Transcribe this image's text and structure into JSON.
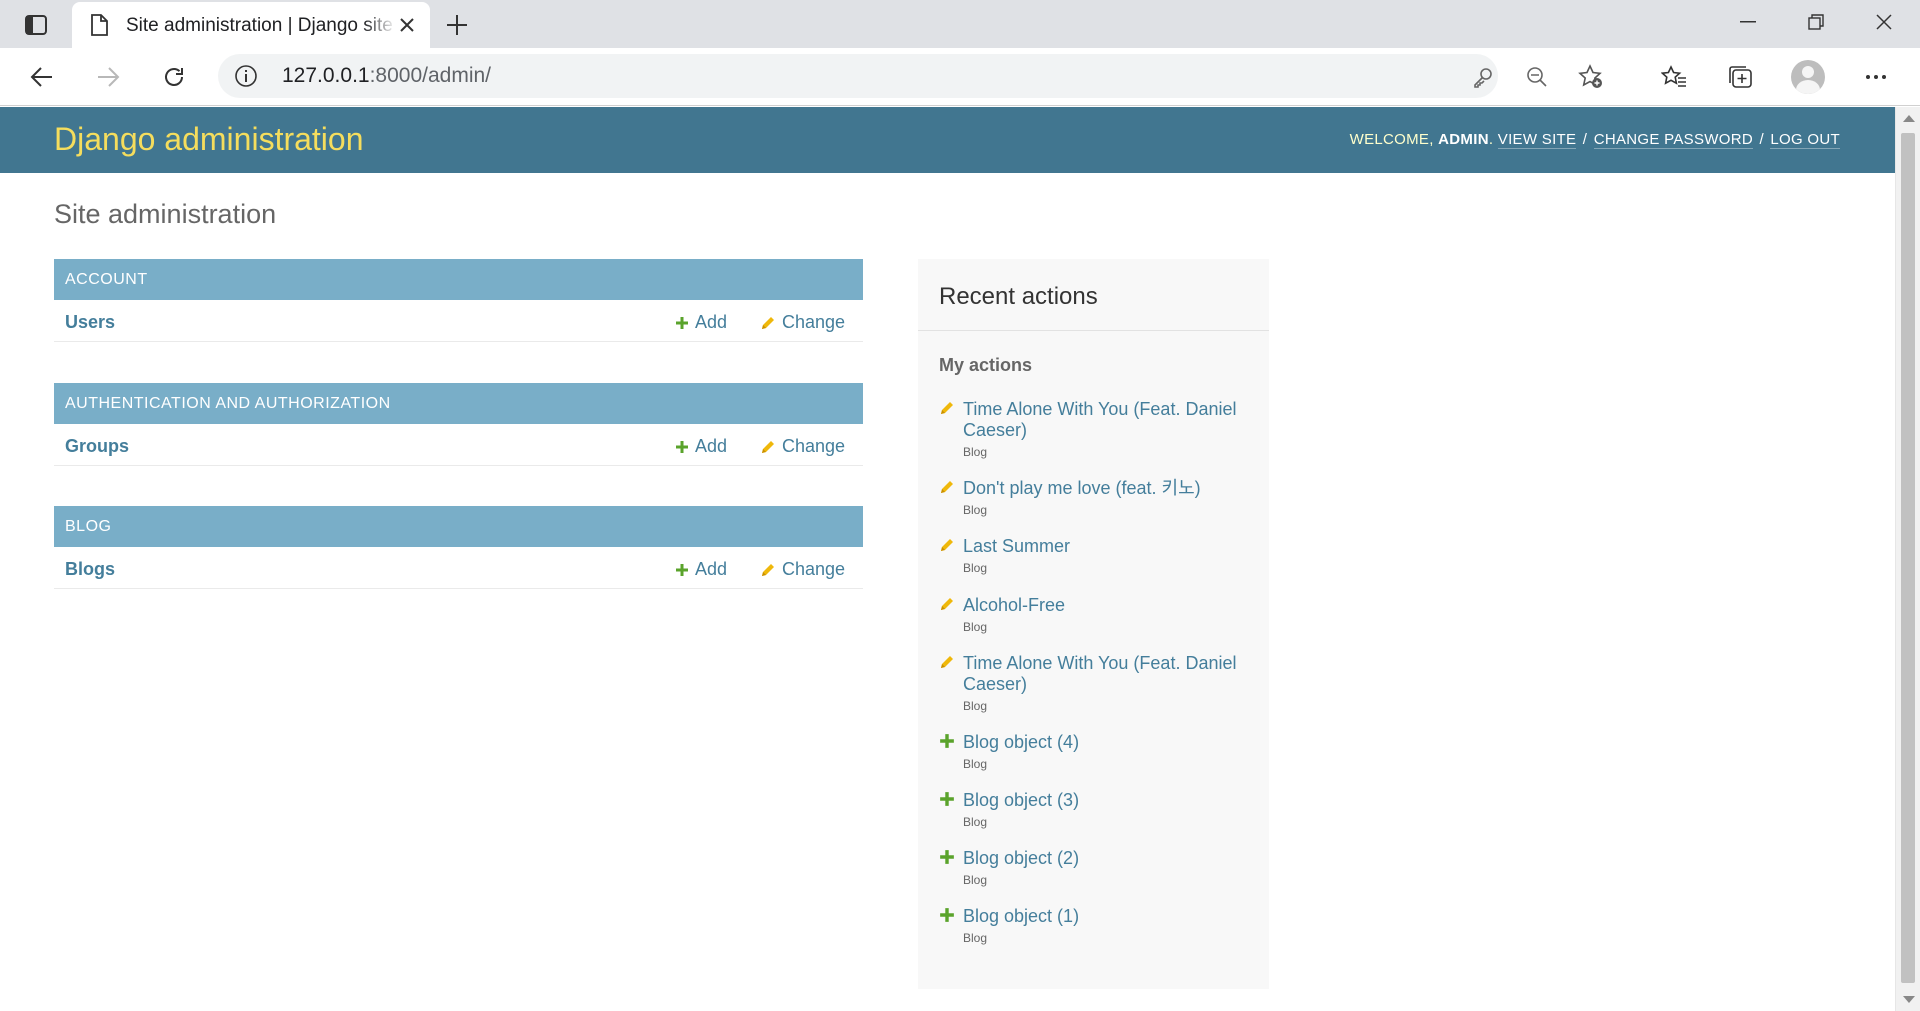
{
  "browser": {
    "tab_title": "Site administration | Django site admin",
    "url_host": "127.0.0.1",
    "url_path": ":8000/admin/",
    "icons": [
      "sidebar-icon",
      "page-icon",
      "close-icon",
      "plus-icon",
      "minimize-icon",
      "restore-icon",
      "close-window-icon",
      "back-icon",
      "forward-icon",
      "refresh-icon",
      "info-icon",
      "key-icon",
      "zoom-out-icon",
      "add-favorite-icon",
      "favorites-icon",
      "collections-icon",
      "profile-icon",
      "more-icon"
    ]
  },
  "header": {
    "branding": "Django administration",
    "welcome": "Welcome,",
    "username": "admin",
    "view_site": "View site",
    "change_password": "Change password",
    "log_out": "Log out"
  },
  "page": {
    "title": "Site administration"
  },
  "modules": [
    {
      "caption": "Account",
      "model": "Users",
      "add": "Add",
      "change": "Change"
    },
    {
      "caption": "Authentication and Authorization",
      "model": "Groups",
      "add": "Add",
      "change": "Change"
    },
    {
      "caption": "Blog",
      "model": "Blogs",
      "add": "Add",
      "change": "Change"
    }
  ],
  "recent_actions": {
    "title": "Recent actions",
    "subtitle": "My actions",
    "items": [
      {
        "kind": "change",
        "text": "Time Alone With You (Feat. Daniel Caeser)",
        "type": "Blog"
      },
      {
        "kind": "change",
        "text": "Don't play me love (feat. 키노)",
        "type": "Blog"
      },
      {
        "kind": "change",
        "text": "Last Summer",
        "type": "Blog"
      },
      {
        "kind": "change",
        "text": "Alcohol-Free",
        "type": "Blog"
      },
      {
        "kind": "change",
        "text": "Time Alone With You (Feat. Daniel Caeser)",
        "type": "Blog"
      },
      {
        "kind": "add",
        "text": "Blog object (4)",
        "type": "Blog"
      },
      {
        "kind": "add",
        "text": "Blog object (3)",
        "type": "Blog"
      },
      {
        "kind": "add",
        "text": "Blog object (2)",
        "type": "Blog"
      },
      {
        "kind": "add",
        "text": "Blog object (1)",
        "type": "Blog"
      }
    ]
  },
  "colors": {
    "header_bg": "#417690",
    "branding": "#f5dd5d",
    "module_caption_bg": "#79aec8",
    "link": "#447e9b",
    "add_icon": "#5aa32b",
    "change_icon": "#efb80b"
  }
}
